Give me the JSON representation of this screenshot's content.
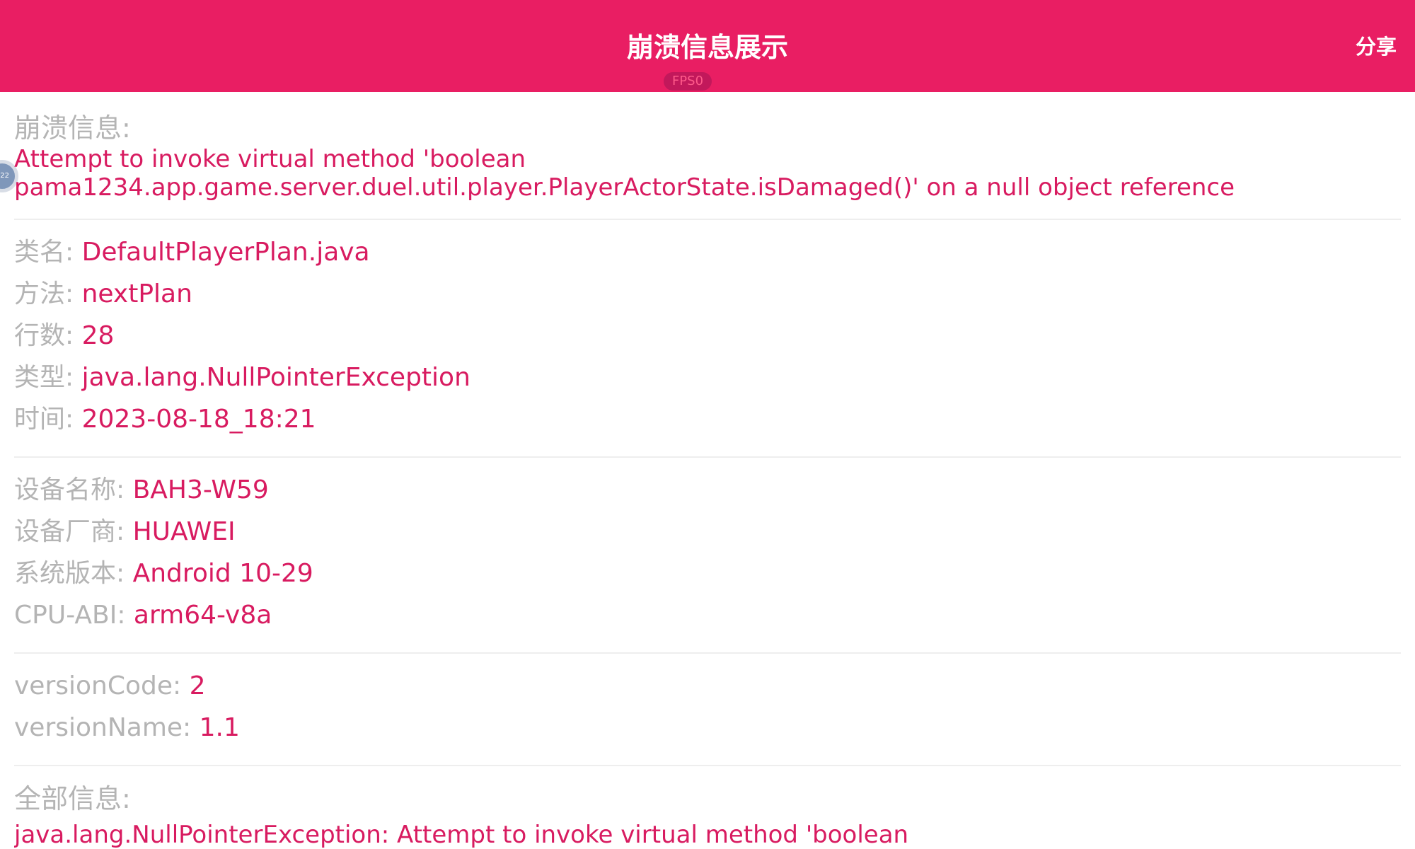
{
  "header": {
    "title": "崩溃信息展示",
    "share_label": "分享",
    "fps_label": "FPS0",
    "floating_ball_label": "22"
  },
  "crash": {
    "title": "崩溃信息:",
    "message": "Attempt to invoke virtual method 'boolean pama1234.app.game.server.duel.util.player.PlayerActorState.isDamaged()' on a null object reference"
  },
  "location": {
    "class_label": "类名:",
    "class_value": "DefaultPlayerPlan.java",
    "method_label": "方法:",
    "method_value": "nextPlan",
    "line_label": "行数:",
    "line_value": "28",
    "type_label": "类型:",
    "type_value": "java.lang.NullPointerException",
    "time_label": "时间:",
    "time_value": "2023-08-18_18:21"
  },
  "device": {
    "name_label": "设备名称:",
    "name_value": "BAH3-W59",
    "vendor_label": "设备厂商:",
    "vendor_value": "HUAWEI",
    "os_label": "系统版本:",
    "os_value": "Android 10-29",
    "abi_label": "CPU-ABI:",
    "abi_value": "arm64-v8a"
  },
  "version": {
    "code_label": "versionCode:",
    "code_value": "2",
    "name_label": "versionName:",
    "name_value": "1.1"
  },
  "all_info": {
    "title": "全部信息:",
    "text": "java.lang.NullPointerException: Attempt to invoke virtual method 'boolean"
  },
  "colors": {
    "accent": "#e91e63",
    "value_text": "#d81b60",
    "label_text": "#b4b4b4",
    "divider": "#eeeeee",
    "background": "#ffffff"
  }
}
